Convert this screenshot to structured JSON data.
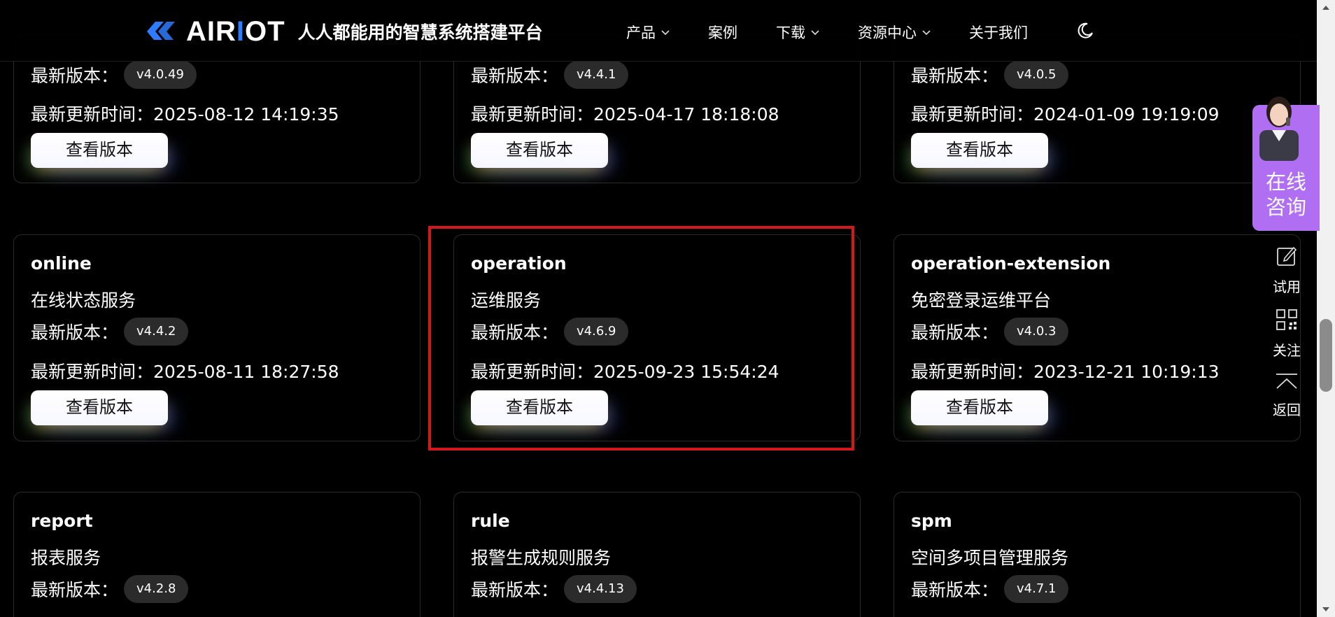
{
  "header": {
    "brand_prefix": "AIR",
    "brand_mid": "I",
    "brand_suffix": "OT",
    "slogan": "人人都能用的智慧系统搭建平台",
    "nav": [
      {
        "label": "产品"
      },
      {
        "label": "案例"
      },
      {
        "label": "下载"
      },
      {
        "label": "资源中心"
      },
      {
        "label": "关于我们"
      }
    ]
  },
  "labels": {
    "version_prefix": "最新版本：",
    "updated_prefix": "最新更新时间：",
    "view_button": "查看版本"
  },
  "cards_row1": [
    {
      "version": "v4.0.49",
      "updated": "2025-08-12 14:19:35"
    },
    {
      "version": "v4.4.1",
      "updated": "2025-04-17 18:18:08"
    },
    {
      "version": "v4.0.5",
      "updated": "2024-01-09 19:19:09"
    }
  ],
  "cards_row2": [
    {
      "name": "online",
      "desc": "在线状态服务",
      "version": "v4.4.2",
      "updated": "2025-08-11 18:27:58"
    },
    {
      "name": "operation",
      "desc": "运维服务",
      "version": "v4.6.9",
      "updated": "2025-09-23 15:54:24"
    },
    {
      "name": "operation-extension",
      "desc": "免密登录运维平台",
      "version": "v4.0.3",
      "updated": "2023-12-21 10:19:13"
    }
  ],
  "cards_row3": [
    {
      "name": "report",
      "desc": "报表服务",
      "version": "v4.2.8"
    },
    {
      "name": "rule",
      "desc": "报警生成规则服务",
      "version": "v4.4.13"
    },
    {
      "name": "spm",
      "desc": "空间多项目管理服务",
      "version": "v4.7.1"
    }
  ],
  "sidebar": {
    "consult_line1": "在线",
    "consult_line2": "咨询",
    "tools": [
      {
        "label": "试用",
        "icon": "edit-icon"
      },
      {
        "label": "关注",
        "icon": "qr-code-icon"
      },
      {
        "label": "返回",
        "icon": "back-to-top-icon"
      }
    ]
  },
  "colors": {
    "accent_blue": "#2f7bff",
    "highlight_red": "#d3171a",
    "consult_purple": "#b06ff3",
    "badge_bg": "#2b2b2b"
  }
}
